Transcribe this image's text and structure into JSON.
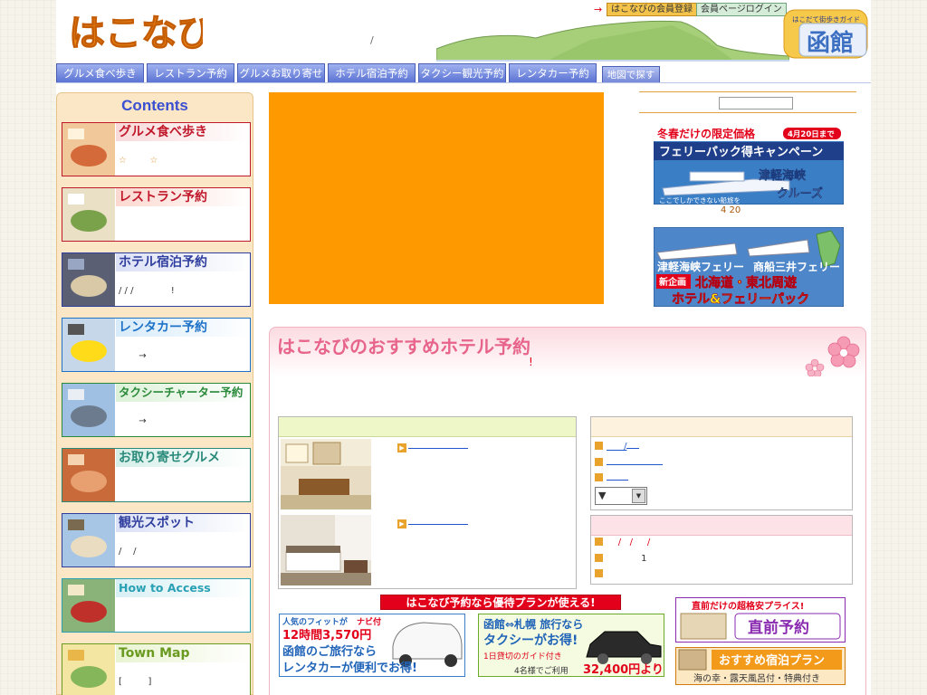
{
  "header": {
    "logo_text": "はこなび",
    "slash": "/",
    "register_arrow": "→",
    "register_label": "はこなびの会員登録",
    "login_label": "会員ページログイン",
    "guide_small": "はこだて街歩きガイド",
    "guide_big": "函館"
  },
  "nav": {
    "tabs": [
      {
        "label": "グルメ食べ歩き"
      },
      {
        "label": "レストラン予約"
      },
      {
        "label": "グルメお取り寄せ"
      },
      {
        "label": "ホテル宿泊予約"
      },
      {
        "label": "タクシー観光予約"
      },
      {
        "label": "レンタカー予約"
      },
      {
        "label": "地図で探す"
      }
    ]
  },
  "sidebar": {
    "title": "Contents",
    "items": [
      {
        "title": "グルメ食べ歩き",
        "sub": "☆        ☆",
        "color": "#c0182a",
        "band": "#f9dada"
      },
      {
        "title": "レストラン予約",
        "sub": "",
        "color": "#c0182a",
        "band": "#fcd9d0"
      },
      {
        "title": "ホテル宿泊予約",
        "sub": "/ / /             !",
        "color": "#2f3e9e",
        "band": "#dbe1f6"
      },
      {
        "title": "レンタカー予約",
        "sub": "       →",
        "color": "#1e73c8",
        "band": "#d7ebfa"
      },
      {
        "title": "タクシーチャーター予約",
        "sub": "       →",
        "color": "#2a8a3a",
        "band": "#dcf1d8"
      },
      {
        "title": "お取り寄せグルメ",
        "sub": "",
        "color": "#2a8a7a",
        "band": "#d6efe9"
      },
      {
        "title": "観光スポット",
        "sub": "/    /",
        "color": "#2f3e9e",
        "band": "#dbe1f6"
      },
      {
        "title": "How to Access",
        "sub": "",
        "color": "#2aa0b5",
        "band": "#d8f0f4"
      },
      {
        "title": "Town Map",
        "sub": "[         ]",
        "color": "#6a9a20",
        "band": "#e9f4d2"
      }
    ]
  },
  "banners": {
    "ferry1": {
      "line1": "冬春だけの限定価格",
      "badge": "4月20日まで",
      "line2": "フェリーパック得キャンペーン",
      "line3": "津軽海峡",
      "line4": "クルーズ",
      "small": "ここでしかできない船旅を",
      "note": "4 20"
    },
    "ferry2": {
      "line1": "津軽海峡フェリー",
      "line2": "商船三井フェリー",
      "tag": "新企画",
      "line3": "北海道・東北周遊",
      "line4": "ホテル&フェリーパック"
    }
  },
  "hotel": {
    "title": "はこなびのおすすめホテル予約",
    "excl": "!",
    "rooms": [
      {
        "link": ""
      },
      {
        "link": ""
      }
    ],
    "right_top_rows": [
      "      /",
      "",
      ""
    ],
    "select_value": "▼",
    "right_bottom_rows": [
      "    /   /     /",
      "            1",
      ""
    ]
  },
  "promo": {
    "label": "はこなび予約なら優待プランが使える!",
    "rental": {
      "line1": "人気のフィットが",
      "line1b": "ナビ付",
      "line2": "12時間3,570円",
      "line3": "函館のご旅行なら",
      "line4": "レンタカーが便利でお得!"
    },
    "taxi": {
      "line1": "函館⇔札幌 旅行なら",
      "line2": "タクシーがお得!",
      "line3": "1日貸切のガイド付き",
      "line4": "4名様でご利用",
      "price": "32,400円より"
    },
    "chokuzen": {
      "line1": "直前だけの超格安プライス!",
      "line2": "直前予約"
    },
    "osusume": {
      "line1": "おすすめ宿泊プラン",
      "line2": "海の幸・露天風呂付・特典付き"
    }
  }
}
